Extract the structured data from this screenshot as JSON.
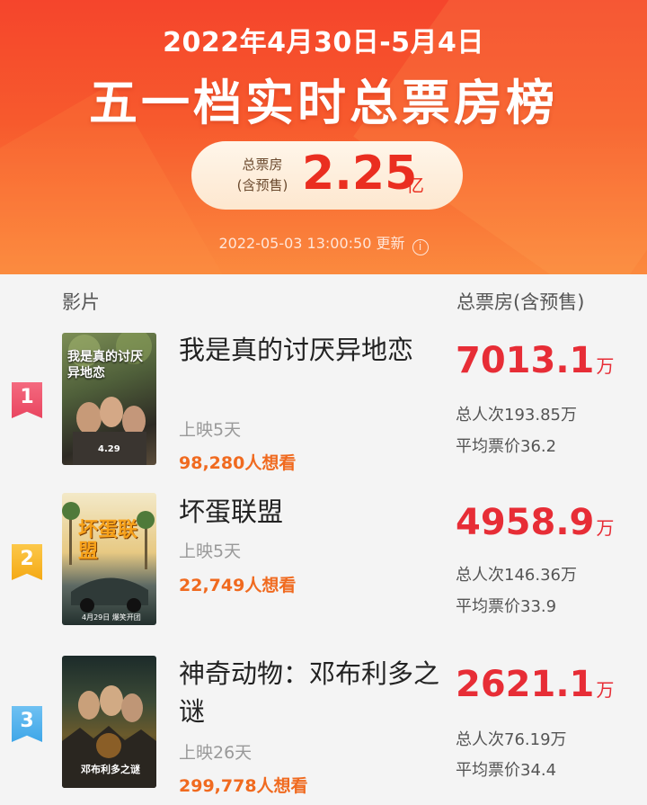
{
  "header": {
    "date_range": "2022年4月30日-5月4日",
    "title": "五一档实时总票房榜",
    "total_label_line1": "总票房",
    "total_label_line2": "(含预售)",
    "total_value": "2.25",
    "total_unit": "亿",
    "update_time": "2022-05-03 13:00:50 更新",
    "info_icon": "info-icon"
  },
  "columns": {
    "film": "影片",
    "box_office": "总票房(含预售)"
  },
  "films": [
    {
      "rank": "1",
      "title": "我是真的讨厌异地恋",
      "days": "上映5天",
      "wants": "98,280人想看",
      "box_value": "7013.1",
      "box_unit": "万",
      "viewers": "总人次193.85万",
      "avg_price": "平均票价36.2",
      "poster_text": "我是真的讨厌异地恋",
      "poster_date": "4.29"
    },
    {
      "rank": "2",
      "title": "坏蛋联盟",
      "days": "上映5天",
      "wants": "22,749人想看",
      "box_value": "4958.9",
      "box_unit": "万",
      "viewers": "总人次146.36万",
      "avg_price": "平均票价33.9",
      "poster_text": "坏蛋联盟",
      "poster_date": "4月29日 爆笑开团"
    },
    {
      "rank": "3",
      "title": "神奇动物：邓布利多之谜",
      "days": "上映26天",
      "wants": "299,778人想看",
      "box_value": "2621.1",
      "box_unit": "万",
      "viewers": "总人次76.19万",
      "avg_price": "平均票价34.4",
      "poster_text": "邓布利多之谜"
    }
  ],
  "colors": {
    "header_top": "#f5452c",
    "accent_red": "#e72d36",
    "wants_orange": "#f06a1f",
    "rank1": "#e94560",
    "rank2": "#f4a914",
    "rank3": "#3ea6e8"
  }
}
